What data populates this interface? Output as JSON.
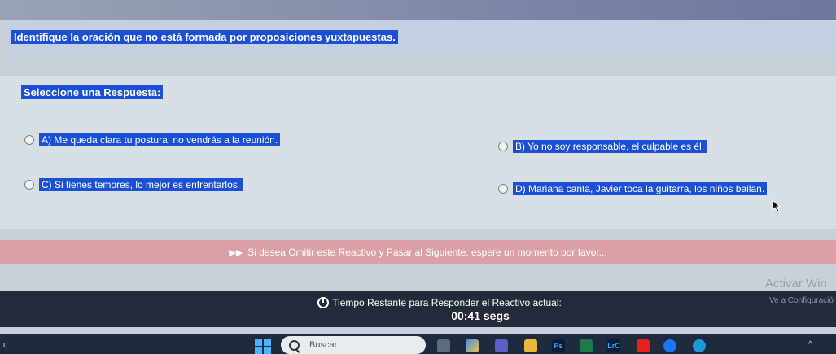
{
  "question": {
    "text": "Identifique la oración que no está formada por proposiciones yuxtapuestas."
  },
  "prompt": "Seleccione una Respuesta:",
  "options": [
    {
      "label": "A) Me queda clara tu postura; no vendrás a la reunión."
    },
    {
      "label": "B) Yo no soy responsable, el culpable es él."
    },
    {
      "label": "C) Si tienes temores, lo mejor es enfrentarlos."
    },
    {
      "label": "D) Mariana canta, Javier toca la guitarra, los niños bailan."
    }
  ],
  "skip": {
    "text": "Si desea Omitir este Reactivo y Pasar al Siguiente, espere un momento por favor..."
  },
  "timer": {
    "label": "Tiempo Restante para Responder el Reactivo actual:",
    "value": "00:41 segs"
  },
  "watermark": {
    "line1": "Activar Win",
    "line2": "Ve a Configuració"
  },
  "taskbar": {
    "search_placeholder": "Buscar",
    "left_glyph": "c",
    "ps_label": "Ps",
    "lrc_label": "LrC",
    "right_glyph": "^"
  },
  "colors": {
    "highlight": "#1b4fd6",
    "skip_bar": "#dba0a5",
    "timer_bar": "#232a3a",
    "taskbar": "#1e2a3d"
  }
}
